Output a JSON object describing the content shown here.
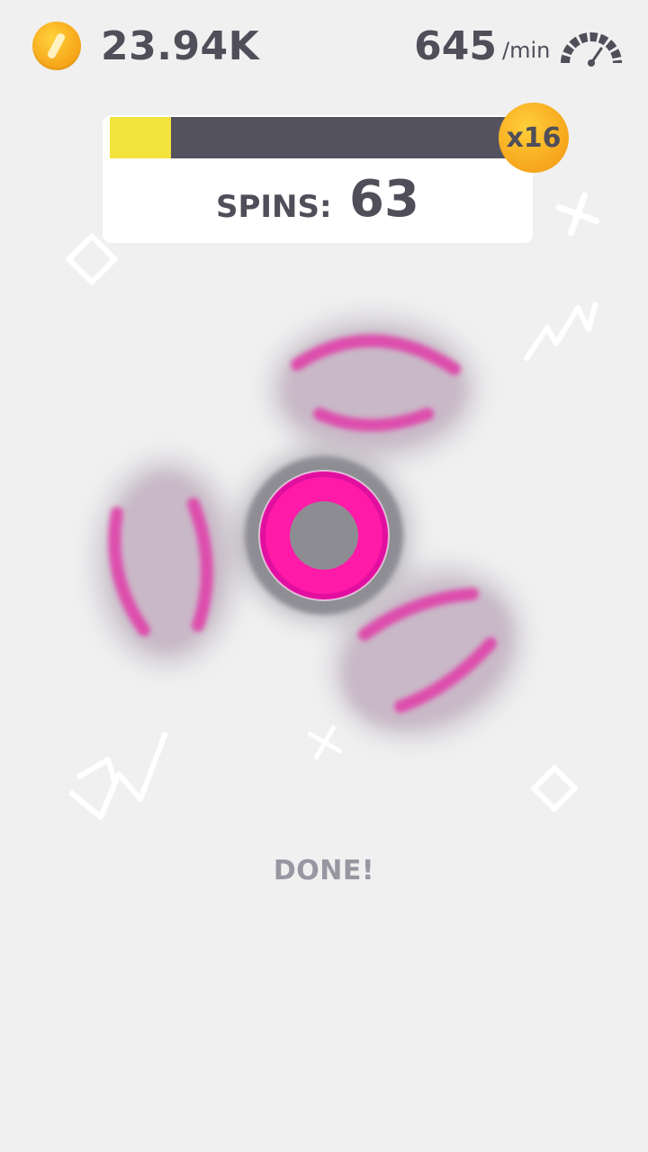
{
  "hud": {
    "coins": "23.94K",
    "rate": "645",
    "rate_unit": "/min",
    "coin_icon": "coin-icon",
    "speed_icon": "speedometer-icon"
  },
  "progress": {
    "fraction": 0.155,
    "multiplier": "x16",
    "spins_label": "SPINS:",
    "spins_value": "63"
  },
  "colors": {
    "background": "#f0f0f1",
    "text_dark": "#4f4e59",
    "progress_fill": "#f2e33d",
    "progress_track": "#54525f",
    "coin_orange": "#f7a91c",
    "spinner_accent": "#ff1aa8",
    "spinner_body": "#8e8c93"
  },
  "done_label": "DONE!"
}
